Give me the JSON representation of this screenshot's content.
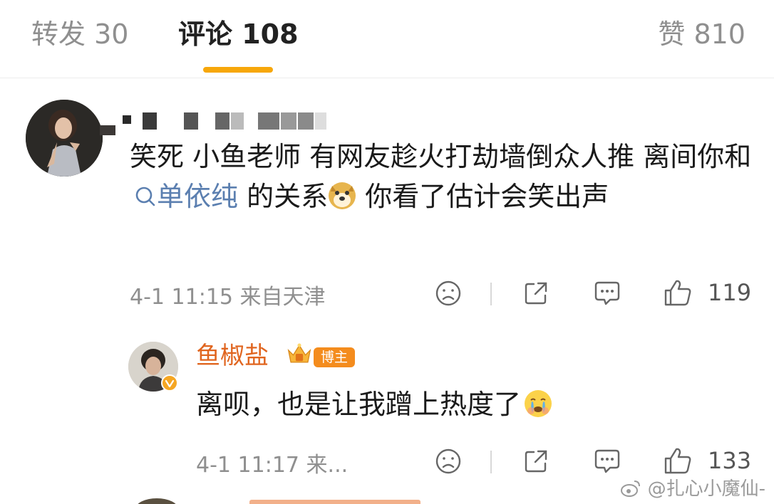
{
  "tabs": {
    "repost": "转发 30",
    "comments": "评论 108",
    "likes": "赞 810"
  },
  "colors": {
    "accent": "#ff8200",
    "indicator": "#f7a70a",
    "link": "#5b7fb0",
    "username_orange": "#e0651f",
    "badge_bg": "#f48c1d"
  },
  "comment": {
    "text_before": "笑死 小鱼老师 有网友趁火打劫墙倒众人推 离间你和",
    "topic_icon": "search-icon",
    "topic": "单依纯",
    "text_middle": " 的关系",
    "emoji_1": "doge-emoji",
    "text_after": " 你看了估计会笑出声",
    "time": "4-1 11:15",
    "location": "来自天津",
    "like_count": "119",
    "icons": [
      "frown-icon",
      "share-icon",
      "comment-icon",
      "thumbs-up-icon"
    ]
  },
  "reply": {
    "username": "鱼椒盐",
    "badge": "博主",
    "text": "离呗，也是让我蹭上热度了",
    "emoji": "crying-emoji",
    "time": "4-1 11:17",
    "location": "来...",
    "like_count": "133"
  },
  "watermark": "@扎心小魔仙-"
}
